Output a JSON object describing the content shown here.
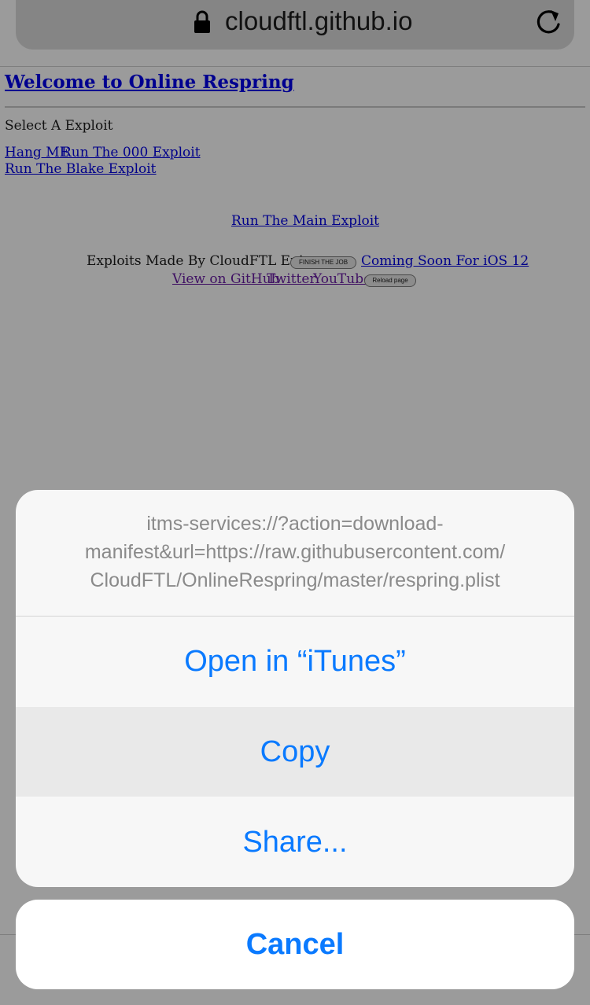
{
  "address_bar": {
    "url": "cloudftl.github.io",
    "lock_icon": "lock-icon",
    "reload_icon": "reload-icon"
  },
  "page": {
    "title": "Welcome to Online Respring",
    "select_label": "Select A Exploit",
    "links": {
      "hang_me": "Hang ME",
      "run_000": "Run The 000 Exploit",
      "run_blake": "Run The Blake Exploit",
      "run_main": "Run The Main Exploit",
      "coming_soon": "Coming Soon For iOS 12",
      "view_github": "View on GitHub",
      "twitter": "Twitter",
      "youtube": "YouTube"
    },
    "credit_text": "Exploits Made By CloudFTL Enjoy",
    "buttons": {
      "finish_job": "FINISH THE JOB",
      "reload_page": "Reload page"
    }
  },
  "action_sheet": {
    "message_lines": [
      "itms-services://?action=download-",
      "manifest&url=https://raw.githubusercontent.com/",
      "CloudFTL/OnlineRespring/master/respring.plist"
    ],
    "open_itunes": "Open in “iTunes”",
    "copy": "Copy",
    "share": "Share...",
    "cancel": "Cancel"
  },
  "colors": {
    "ios_blue": "#0a7aff",
    "link_blue": "#00008a",
    "dim_overlay": "#9b9b9b"
  }
}
